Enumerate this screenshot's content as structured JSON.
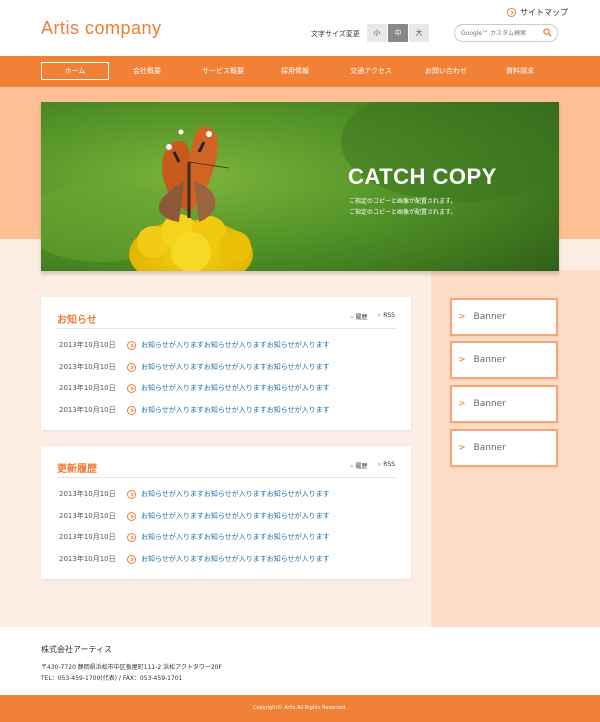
{
  "header": {
    "logo": "Artis company",
    "sitemap_label": "サイトマップ",
    "fontsize_label": "文字サイズ変更",
    "fontsize_options": [
      "小",
      "中",
      "大"
    ],
    "fontsize_selected": "中",
    "search_placeholder": "Google™ カスタム検索"
  },
  "nav": {
    "items": [
      {
        "label": "ホーム",
        "active": true
      },
      {
        "label": "会社概要"
      },
      {
        "label": "サービス概要"
      },
      {
        "label": "採用情報"
      },
      {
        "label": "交通アクセス"
      },
      {
        "label": "お問い合わせ"
      },
      {
        "label": "資料請求"
      }
    ]
  },
  "hero": {
    "catch_title": "CATCH COPY",
    "catch_lines": [
      "ご指定のコピーと画像が配置されます。",
      "ご指定のコピーと画像が配置されます。"
    ]
  },
  "news": {
    "title": "お知らせ",
    "link_history": "履歴",
    "link_rss": "RSS",
    "rows": [
      {
        "date": "2013年10月10日",
        "text": "お知らせが入りますお知らせが入りますお知らせが入ります"
      },
      {
        "date": "2013年10月10日",
        "text": "お知らせが入りますお知らせが入りますお知らせが入ります"
      },
      {
        "date": "2013年10月10日",
        "text": "お知らせが入りますお知らせが入りますお知らせが入ります"
      },
      {
        "date": "2013年10月10日",
        "text": "お知らせが入りますお知らせが入りますお知らせが入ります"
      }
    ]
  },
  "updates": {
    "title": "更新履歴",
    "link_history": "履歴",
    "link_rss": "RSS",
    "rows": [
      {
        "date": "2013年10月10日",
        "text": "お知らせが入りますお知らせが入りますお知らせが入ります"
      },
      {
        "date": "2013年10月10日",
        "text": "お知らせが入りますお知らせが入りますお知らせが入ります"
      },
      {
        "date": "2013年10月10日",
        "text": "お知らせが入りますお知らせが入りますお知らせが入ります"
      },
      {
        "date": "2013年10月10日",
        "text": "お知らせが入りますお知らせが入りますお知らせが入ります"
      }
    ]
  },
  "banners": [
    "Banner",
    "Banner",
    "Banner",
    "Banner"
  ],
  "footer": {
    "company": "株式会社アーティス",
    "address": "〒430-7720 静岡県浜松市中区板屋町111-2 浜松アクトタワー20F",
    "tel": "TEL：053-459-1700(代表) / FAX：053-459-1701",
    "copyright": "Copyright© Artis All Rights Reserved."
  },
  "colors": {
    "accent": "#f28138",
    "band": "#ffbf94",
    "page_bg": "#fdeee5",
    "link": "#1e6fa8"
  }
}
